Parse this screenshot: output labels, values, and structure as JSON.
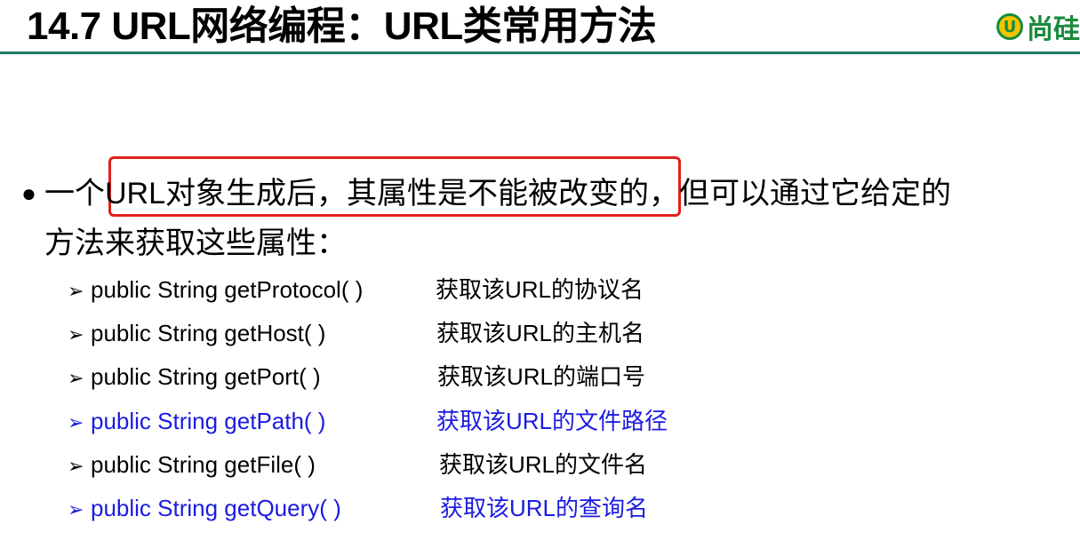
{
  "header": {
    "title": "14.7 URL网络编程：URL类常用方法",
    "logo_text": "尚硅",
    "logo_mark": "U",
    "rule_color": "#1f7a63",
    "logo_color": "#1a8a3c"
  },
  "bullet": {
    "symbol": "●",
    "line1_before": "一个",
    "line1_highlight": "URL对象生成后，其属性是不能被改变",
    "line1_after": "的，但可以通过它给定的",
    "line2": "方法来获取这些属性：",
    "highlight_color": "#e0201c"
  },
  "methods": [
    {
      "signature": "public String getProtocol(  )",
      "description": "获取该URL的协议名",
      "color": "#000000"
    },
    {
      "signature": "public String getHost(  )",
      "description": "获取该URL的主机名",
      "color": "#000000"
    },
    {
      "signature": "public String getPort(  )",
      "description": "获取该URL的端口号",
      "color": "#000000"
    },
    {
      "signature": "public String getPath(  )",
      "description": "获取该URL的文件路径",
      "color": "#1b1be0"
    },
    {
      "signature": "public String getFile(  )",
      "description": "获取该URL的文件名",
      "color": "#000000"
    },
    {
      "signature": "public String getQuery(   )",
      "description": "获取该URL的查询名",
      "color": "#1b1be0"
    }
  ],
  "arrow_symbol": "➢"
}
